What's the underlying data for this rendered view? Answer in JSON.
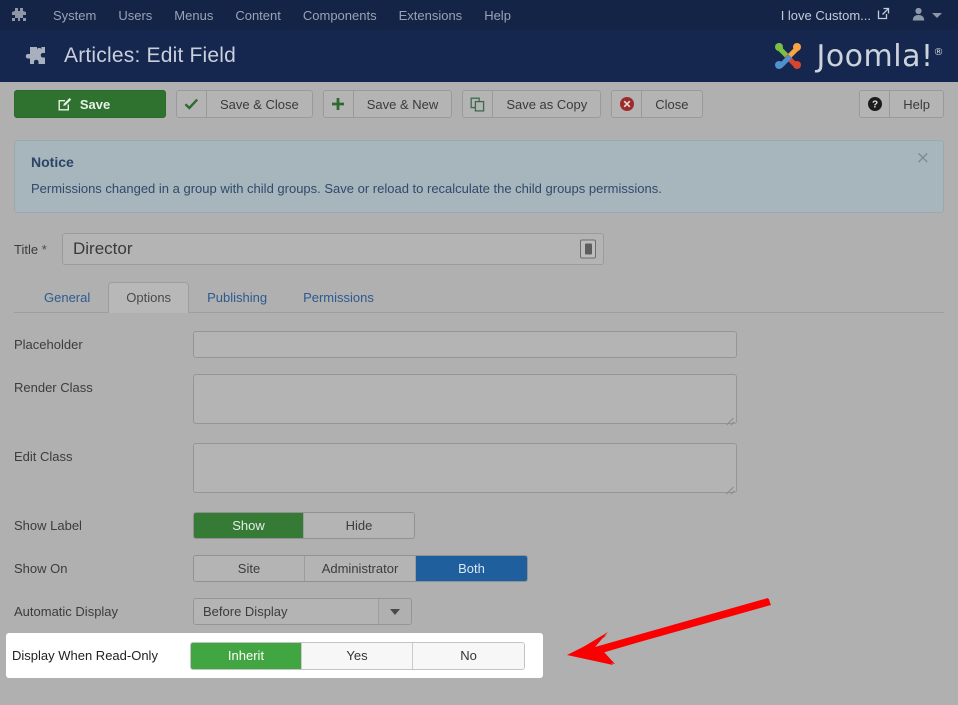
{
  "topbar": {
    "brand_icon": "joomla-logo-icon",
    "nav_items": [
      {
        "label": "System"
      },
      {
        "label": "Users"
      },
      {
        "label": "Menus"
      },
      {
        "label": "Content"
      },
      {
        "label": "Components"
      },
      {
        "label": "Extensions"
      },
      {
        "label": "Help"
      }
    ],
    "site_link": {
      "label": "I love Custom...",
      "icon": "external-link-icon"
    },
    "user_menu": {
      "icon": "user-icon",
      "caret": "chevron-down-icon"
    }
  },
  "header": {
    "icon": "puzzle-piece-icon",
    "title": "Articles: Edit Field",
    "logo_text": "Joomla!",
    "logo_reg": "®"
  },
  "toolbar": {
    "save": {
      "label": "Save",
      "icon": "edit-square-icon"
    },
    "save_close": {
      "label": "Save & Close",
      "icon": "check-icon"
    },
    "save_new": {
      "label": "Save & New",
      "icon": "plus-icon"
    },
    "save_copy": {
      "label": "Save as Copy",
      "icon": "copy-icon"
    },
    "close": {
      "label": "Close",
      "icon": "cancel-circle-icon"
    },
    "help": {
      "label": "Help",
      "icon": "question-circle-icon"
    }
  },
  "notice": {
    "title": "Notice",
    "message": "Permissions changed in a group with child groups. Save or reload to recalculate the child groups permissions.",
    "close_label": "×"
  },
  "title_field": {
    "label": "Title",
    "required_mark": "*",
    "value": "Director",
    "badge_icon": "field-type-icon"
  },
  "tabs": [
    {
      "label": "General",
      "active": false
    },
    {
      "label": "Options",
      "active": true
    },
    {
      "label": "Publishing",
      "active": false
    },
    {
      "label": "Permissions",
      "active": false
    }
  ],
  "form": {
    "placeholder": {
      "label": "Placeholder",
      "value": "",
      "placeholder": ""
    },
    "render_class": {
      "label": "Render Class",
      "value": "",
      "placeholder": ""
    },
    "edit_class": {
      "label": "Edit Class",
      "value": "",
      "placeholder": ""
    },
    "show_label": {
      "label": "Show Label",
      "options": [
        {
          "label": "Show",
          "active": true,
          "style": "green"
        },
        {
          "label": "Hide",
          "active": false,
          "style": ""
        }
      ]
    },
    "show_on": {
      "label": "Show On",
      "options": [
        {
          "label": "Site",
          "active": false,
          "style": ""
        },
        {
          "label": "Administrator",
          "active": false,
          "style": ""
        },
        {
          "label": "Both",
          "active": true,
          "style": "blue"
        }
      ]
    },
    "automatic_display": {
      "label": "Automatic Display",
      "value": "Before Display",
      "caret": "chevron-down-icon"
    },
    "display_when_readonly": {
      "label": "Display When Read-Only",
      "options": [
        {
          "label": "Inherit",
          "active": true,
          "style": "green"
        },
        {
          "label": "Yes",
          "active": false,
          "style": ""
        },
        {
          "label": "No",
          "active": false,
          "style": ""
        }
      ]
    }
  },
  "annotation": {
    "arrow_color": "#fb0000",
    "points_to": "display-when-readonly-row"
  },
  "colors": {
    "topbar_bg": "#142446",
    "subhead_bg": "#15274f",
    "page_bg": "#b0b0b0",
    "save_green": "#2f7230",
    "active_green": "#357a35",
    "active_blue": "#1f5f9e",
    "notice_bg": "#a7b5bc",
    "highlight_green": "#41a541"
  }
}
